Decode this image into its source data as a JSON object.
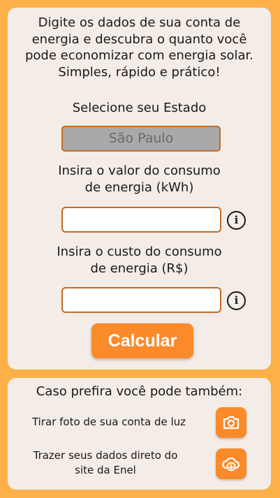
{
  "calculator": {
    "intro_lines": [
      "Digite os dados de sua conta de",
      "energia e descubra o quanto você",
      "pode economizar com energia solar.",
      "Simples, rápido e prático!"
    ],
    "state_label": "Selecione seu Estado",
    "state_value": "São Paulo",
    "consumption_label": [
      "Insira o valor do consumo",
      "de energia (kWh)"
    ],
    "consumption_value": "",
    "cost_label": [
      "Insira o custo do consumo",
      "de energia (R$)"
    ],
    "cost_value": "",
    "info_glyph": "i",
    "calculate_label": "Calcular"
  },
  "alternatives": {
    "title": "Caso prefira você pode também:",
    "photo_text": "Tirar foto de sua conta de luz",
    "enel_text": [
      "Trazer seus dados direto do",
      "site da Enel"
    ],
    "photo_icon": "camera-icon",
    "download_icon": "cloud-download-icon"
  },
  "colors": {
    "background": "#fdb04a",
    "card": "#f3ece7",
    "accent": "#fb8a2a",
    "field_border": "#c46a24",
    "select_bg": "#a9a9a9"
  }
}
